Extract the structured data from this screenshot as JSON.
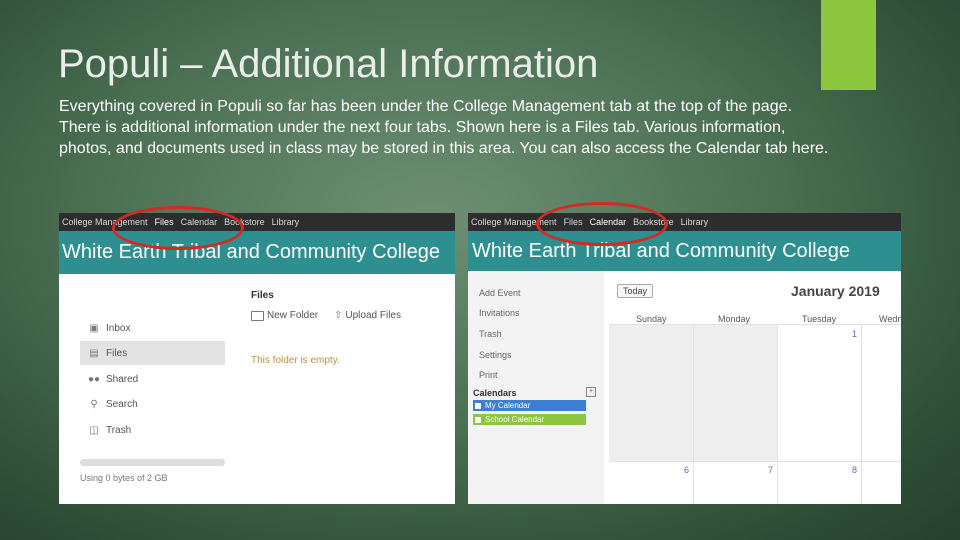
{
  "slide": {
    "title": "Populi – Additional Information",
    "body_lines": [
      "Everything covered in Populi so far has been under the College Management tab at the top of the page.",
      "There is additional information under the next four tabs. Shown here is a Files tab. Various information,",
      "photos, and documents used in class may be stored in this area. You can also access the Calendar tab here."
    ],
    "colors": {
      "accent": "#8dc63f",
      "highlight_oval": "#d42a24",
      "banner": "#2d8f8f"
    }
  },
  "files_shot": {
    "nav_tabs": [
      "College Management",
      "Files",
      "Calendar",
      "Bookstore",
      "Library"
    ],
    "active_tab": "Files",
    "banner": "White Earth Tribal and Community College",
    "heading": "Files",
    "actions": [
      {
        "label": "New Folder",
        "icon": "folder-icon"
      },
      {
        "label": "Upload Files",
        "icon": "upload-icon"
      }
    ],
    "sidebar": [
      {
        "label": "Inbox",
        "icon": "inbox-icon"
      },
      {
        "label": "Files",
        "icon": "file-icon",
        "active": true
      },
      {
        "label": "Shared",
        "icon": "shared-users-icon"
      },
      {
        "label": "Search",
        "icon": "search-icon"
      },
      {
        "label": "Trash",
        "icon": "trash-icon"
      }
    ],
    "empty_message": "This folder is empty.",
    "storage_text": "Using 0 bytes of 2 GB"
  },
  "calendar_shot": {
    "nav_tabs": [
      "College Management",
      "Files",
      "Calendar",
      "Bookstore",
      "Library"
    ],
    "active_tab": "Calendar",
    "banner": "White Earth Tribal and Community College",
    "links": [
      "Add Event",
      "Invitations",
      "Trash",
      "Settings",
      "Print"
    ],
    "calendars_header": "Calendars",
    "calendars": [
      {
        "label": "My Calendar",
        "color": "#3b7fd4"
      },
      {
        "label": "School Calendar",
        "color": "#8dc63f"
      }
    ],
    "today_label": "Today",
    "month": "January 2019",
    "day_names": [
      "Sunday",
      "Monday",
      "Tuesday",
      "Wedn"
    ],
    "dates_row1": [
      "",
      "",
      "1"
    ],
    "dates_row2": [
      "6",
      "7",
      "8"
    ]
  }
}
